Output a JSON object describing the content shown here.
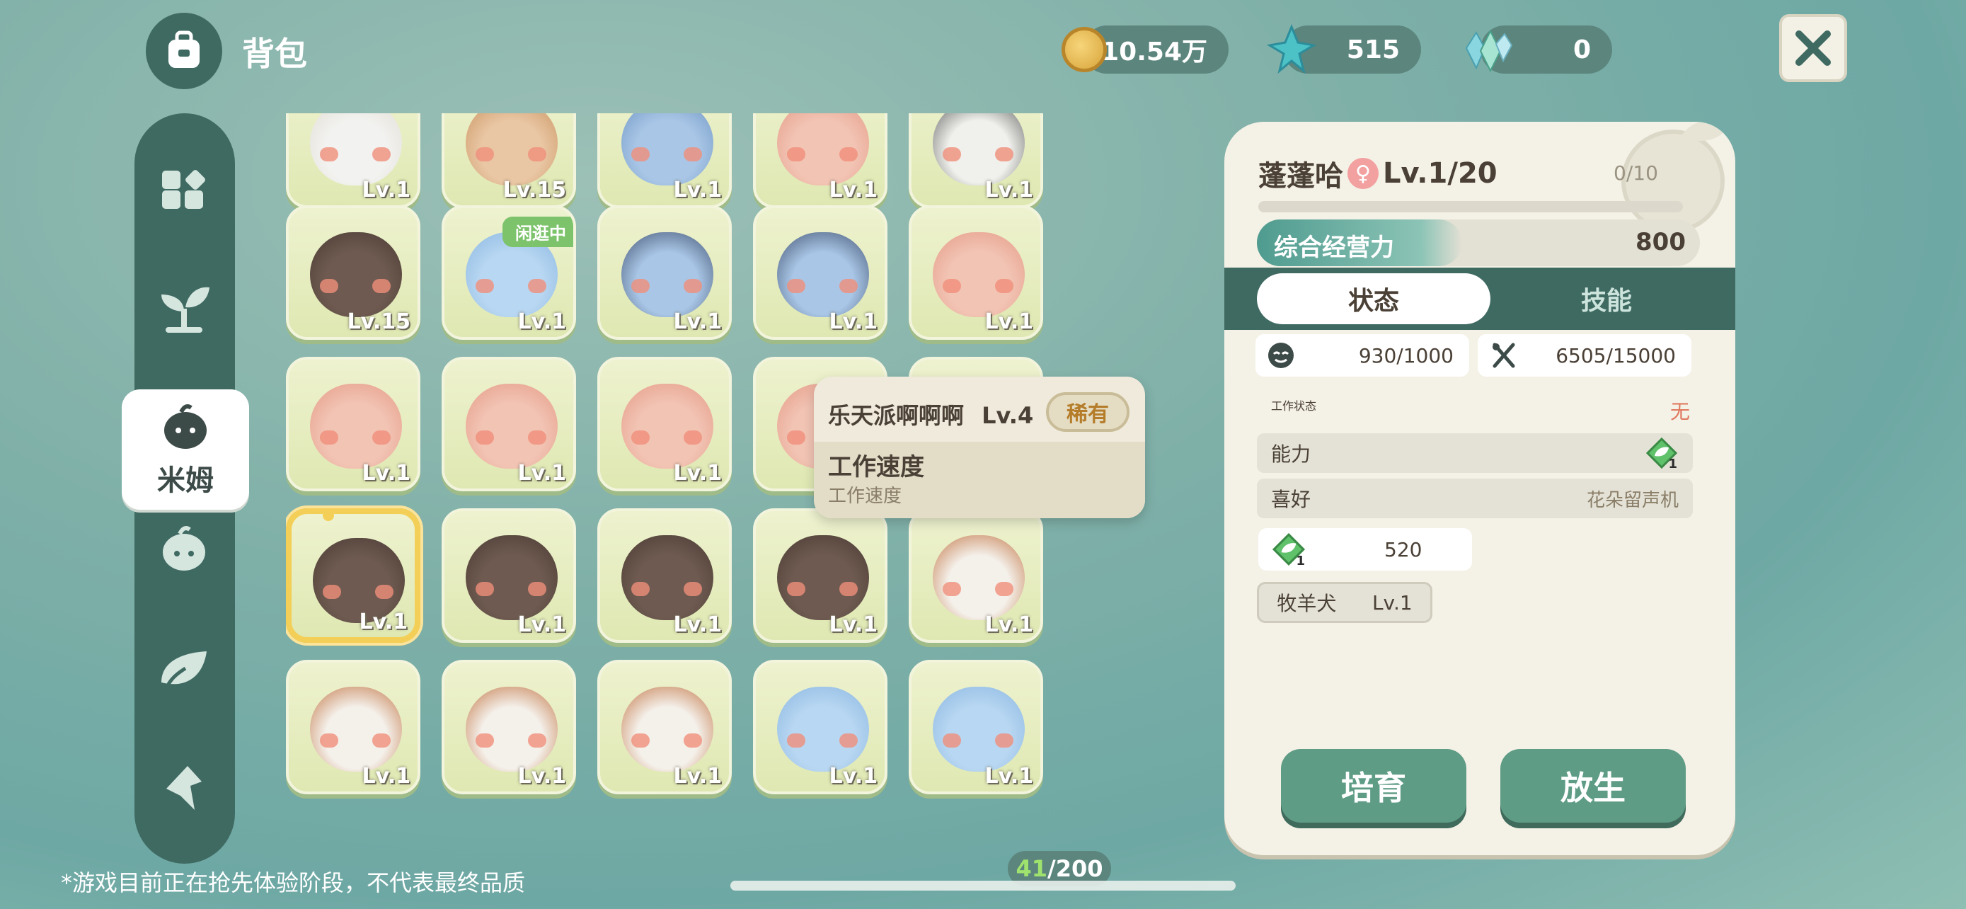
{
  "header": {
    "title": "背包",
    "coins": "10.54万",
    "stars": "515",
    "crystals": "0"
  },
  "sidebar": {
    "active_label": "米姆",
    "items": [
      "grid-icon",
      "sprout-icon",
      "mim-icon",
      "fruit-icon",
      "leaf-icon",
      "bird-icon"
    ]
  },
  "grid": {
    "cards": [
      {
        "level": "Lv.1"
      },
      {
        "level": "Lv.15"
      },
      {
        "level": "Lv.1"
      },
      {
        "level": "Lv.1"
      },
      {
        "level": "Lv.1"
      },
      {
        "level": "Lv.15"
      },
      {
        "level": "Lv.1",
        "tag": "闲逛中"
      },
      {
        "level": "Lv.1"
      },
      {
        "level": "Lv.1"
      },
      {
        "level": "Lv.1"
      },
      {
        "level": "Lv.1"
      },
      {
        "level": "Lv.1"
      },
      {
        "level": "Lv.1"
      },
      {
        "level": ""
      },
      {
        "level": ""
      },
      {
        "level": "Lv.1"
      },
      {
        "level": "Lv.1"
      },
      {
        "level": "Lv.1"
      },
      {
        "level": "Lv.1"
      },
      {
        "level": "Lv.1"
      },
      {
        "level": "Lv.1"
      },
      {
        "level": "Lv.1"
      },
      {
        "level": "Lv.1"
      },
      {
        "level": "Lv.1"
      },
      {
        "level": "Lv.1"
      }
    ]
  },
  "tooltip": {
    "name": "乐天派啊啊啊",
    "level": "Lv.4",
    "rarity": "稀有",
    "skill_title": "工作速度",
    "skill_desc": "工作速度"
  },
  "detail": {
    "name": "蓬蓬哈",
    "gender": "♀",
    "level": "Lv.1/20",
    "exp": "0/10",
    "power_label": "综合经营力",
    "power_value": "800",
    "tab_status": "状态",
    "tab_skill": "技能",
    "mood": "930/1000",
    "food": "6505/15000",
    "work_status_label": "工作状态",
    "work_status_value": "无",
    "ability_label": "能力",
    "ability_badge": "1",
    "hobby_label": "喜好",
    "hobby_value": "花朵留声机",
    "ability_value": "520",
    "ability_value_badge": "1",
    "job": "牧羊犬",
    "job_level": "Lv.1",
    "btn_cultivate": "培育",
    "btn_release": "放生"
  },
  "footer": {
    "disclaimer": "*游戏目前正在抢先体验阶段，不代表最终品质",
    "count_current": "41",
    "count_total": "/200"
  },
  "colors": {
    "accent": "#3f6a62",
    "button": "#5e9c85",
    "selected": "#f3cf57",
    "female": "#f2a0a0",
    "none_red": "#e07a5f"
  }
}
